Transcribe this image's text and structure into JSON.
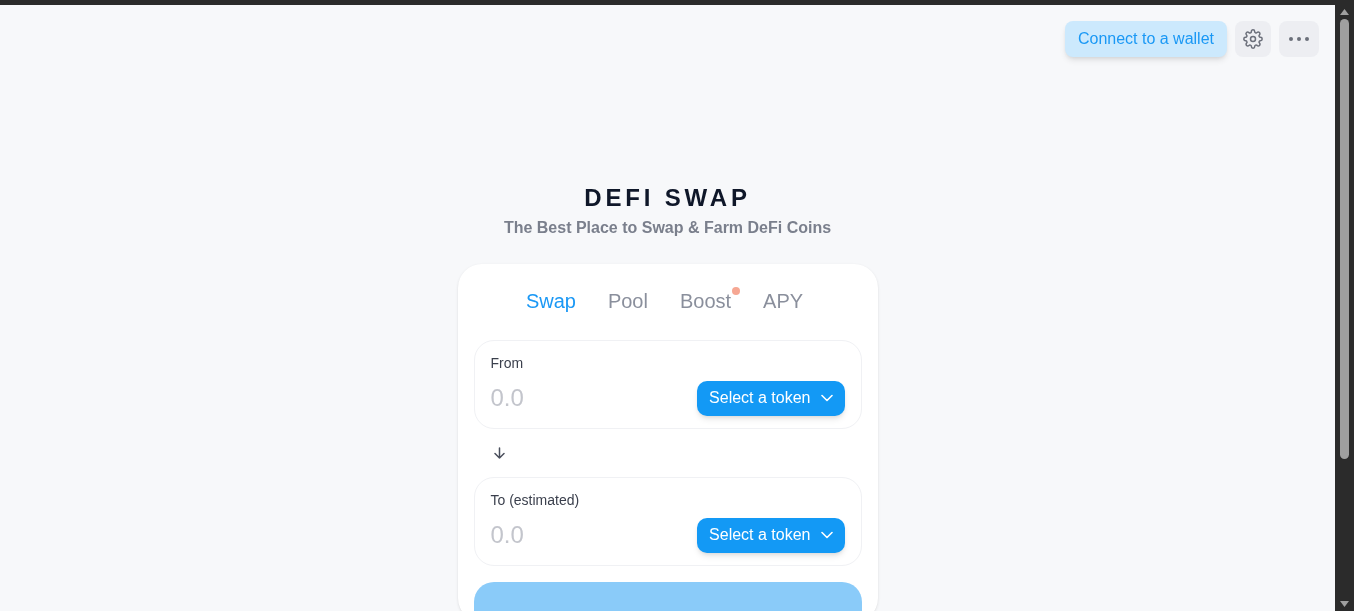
{
  "header": {
    "connect_button": "Connect to a wallet"
  },
  "title": "DEFI SWAP",
  "subtitle": "The Best Place to Swap & Farm DeFi Coins",
  "tabs": [
    {
      "label": "Swap",
      "selected": true,
      "badge": false
    },
    {
      "label": "Pool",
      "selected": false,
      "badge": false
    },
    {
      "label": "Boost",
      "selected": false,
      "badge": true
    },
    {
      "label": "APY",
      "selected": false,
      "badge": false
    }
  ],
  "panels": [
    {
      "label": "From",
      "placeholder": "0.0",
      "token_button": "Select a token"
    },
    {
      "label": "To (estimated)",
      "placeholder": "0.0",
      "token_button": "Select a token"
    }
  ]
}
